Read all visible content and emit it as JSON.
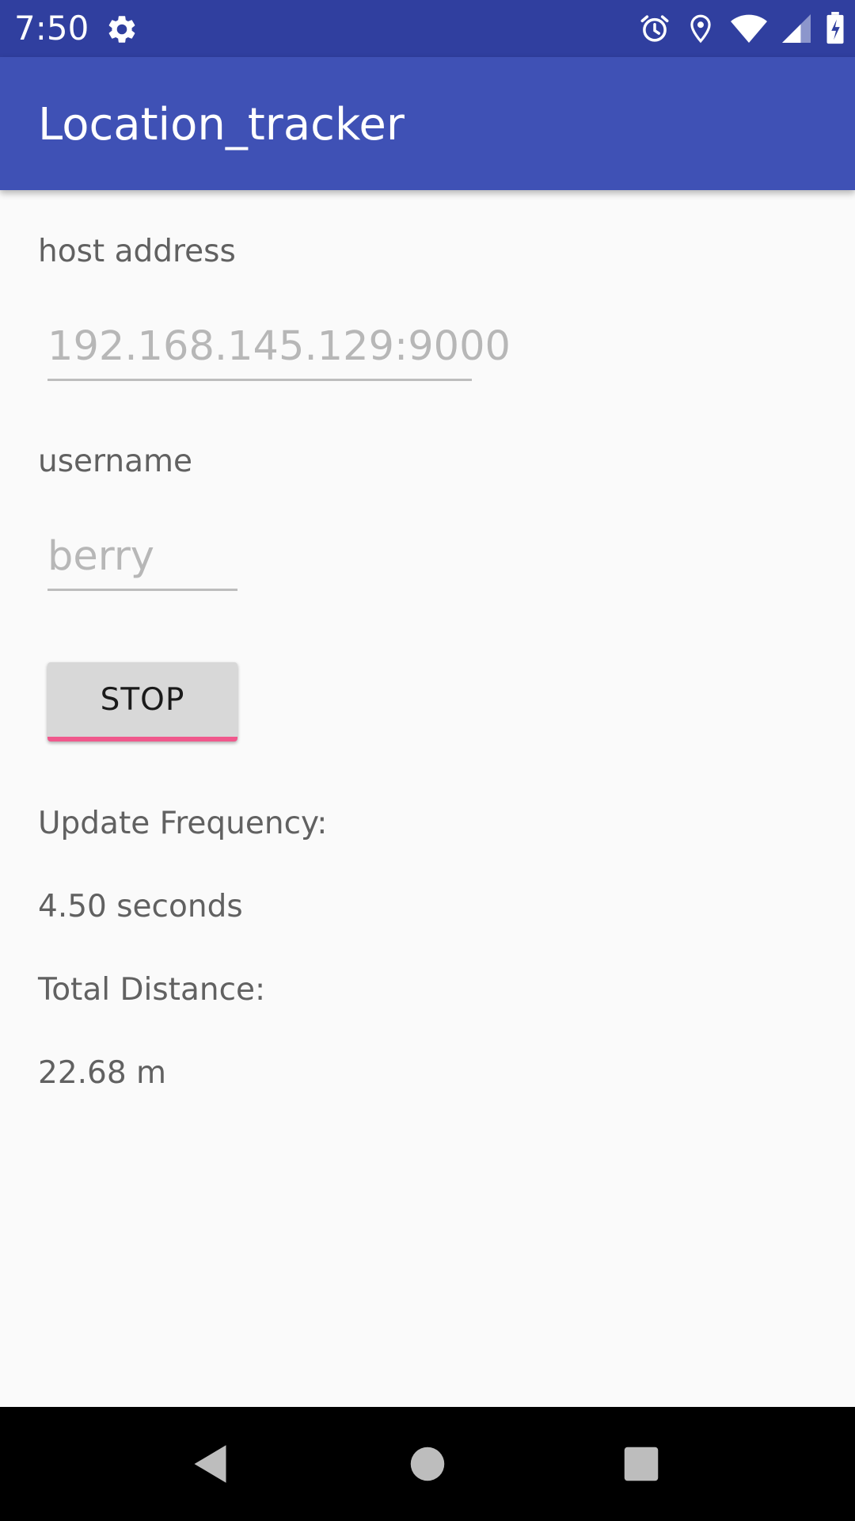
{
  "status_bar": {
    "time": "7:50",
    "icons": [
      "gear-icon",
      "alarm-icon",
      "location-pin-icon",
      "wifi-icon",
      "signal-icon",
      "battery-charging-icon"
    ]
  },
  "app_bar": {
    "title": "Location_tracker"
  },
  "form": {
    "host_label": "host address",
    "host_value": "192.168.145.129:9000",
    "username_label": "username",
    "username_value": "berry",
    "stop_label": "STOP"
  },
  "stats": {
    "frequency_label": "Update Frequency:",
    "frequency_value": "4.50 seconds",
    "distance_label": "Total Distance:",
    "distance_value": "22.68 m"
  },
  "nav_bar": {
    "icons": [
      "back-icon",
      "home-icon",
      "recents-icon"
    ]
  },
  "colors": {
    "status_bar": "#303f9f",
    "app_bar": "#3f51b5",
    "button_accent": "#f0588c"
  }
}
